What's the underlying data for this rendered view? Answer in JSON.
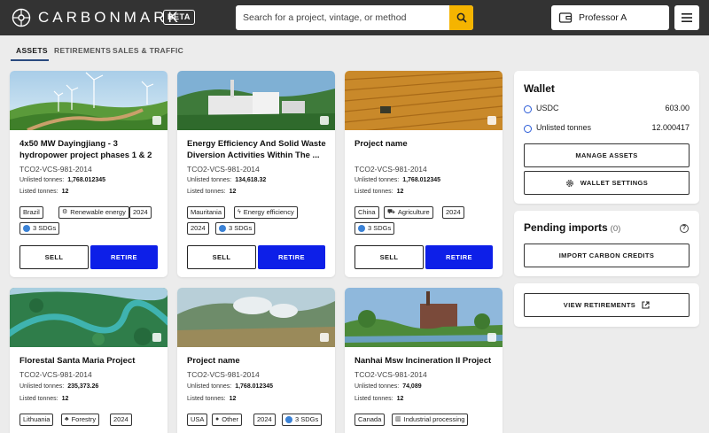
{
  "header": {
    "logo_text": "CARBONMARK",
    "beta_label": "BETA",
    "search_placeholder": "Search for a project, vintage, or method",
    "user_label": "Professor A"
  },
  "tabs": [
    "ASSETS",
    "RETIREMENTS",
    "SALES & TRAFFIC"
  ],
  "cards": [
    {
      "title": "4x50 MW Dayingjiang - 3 hydropower project phases 1 & 2",
      "id": "TCO2-VCS-981-2014",
      "unlisted_label": "Unlisted tonnes:",
      "unlisted": "1,768.012345",
      "listed_label": "Listed tonnes:",
      "listed": "12",
      "tags": [
        "Brazil",
        "Renewable energy",
        "2024",
        "3 SDGs"
      ],
      "sell": "SELL",
      "retire": "RETIRE"
    },
    {
      "title": "Energy Efficiency And Solid Waste Diversion Activities Within The ...",
      "id": "TCO2-VCS-981-2014",
      "unlisted_label": "Unlisted tonnes:",
      "unlisted": "134,618.32",
      "listed_label": "Listed tonnes:",
      "listed": "12",
      "tags": [
        "Mauritania",
        "Energy efficiency",
        "2024",
        "3 SDGs"
      ],
      "sell": "SELL",
      "retire": "RETIRE"
    },
    {
      "title": "Project name",
      "id": "TCO2-VCS-981-2014",
      "unlisted_label": "Unlisted tonnes:",
      "unlisted": "1,768.012345",
      "listed_label": "Listed tonnes:",
      "listed": "12",
      "tags": [
        "China",
        "Agriculture",
        "2024",
        "3 SDGs"
      ],
      "sell": "SELL",
      "retire": "RETIRE"
    },
    {
      "title": "Florestal Santa Maria Project",
      "id": "TCO2-VCS-981-2014",
      "unlisted_label": "Unlisted tonnes:",
      "unlisted": "235,373.26",
      "listed_label": "Listed tonnes:",
      "listed": "12",
      "tags": [
        "Lithuania",
        "Forestry",
        "2024"
      ]
    },
    {
      "title": "Project name",
      "id": "TCO2-VCS-981-2014",
      "unlisted_label": "Unlisted tonnes:",
      "unlisted": "1,768.012345",
      "listed_label": "Listed tonnes:",
      "listed": "12",
      "tags": [
        "USA",
        "Other",
        "2024",
        "3 SDGs"
      ]
    },
    {
      "title": "Nanhai Msw Incineration II Project",
      "id": "TCO2-VCS-981-2014",
      "unlisted_label": "Unlisted tonnes:",
      "unlisted": "74,089",
      "listed_label": "Listed tonnes:",
      "listed": "12",
      "tags": [
        "Canada",
        "Industrial processing"
      ]
    }
  ],
  "wallet": {
    "title": "Wallet",
    "usdc_label": "USDC",
    "usdc_value": "603.00",
    "unlisted_label": "Unlisted tonnes",
    "unlisted_value": "12.000417",
    "manage_label": "MANAGE ASSETS",
    "settings_label": "WALLET SETTINGS"
  },
  "pending": {
    "title": "Pending imports",
    "count": "(0)",
    "import_label": "IMPORT CARBON CREDITS"
  },
  "retirements": {
    "view_label": "VIEW RETIREMENTS"
  },
  "colors": {
    "header_bg": "#333333",
    "search_button": "#f5b400",
    "retire_button": "#0d1fe8",
    "page_bg": "#ececec"
  }
}
